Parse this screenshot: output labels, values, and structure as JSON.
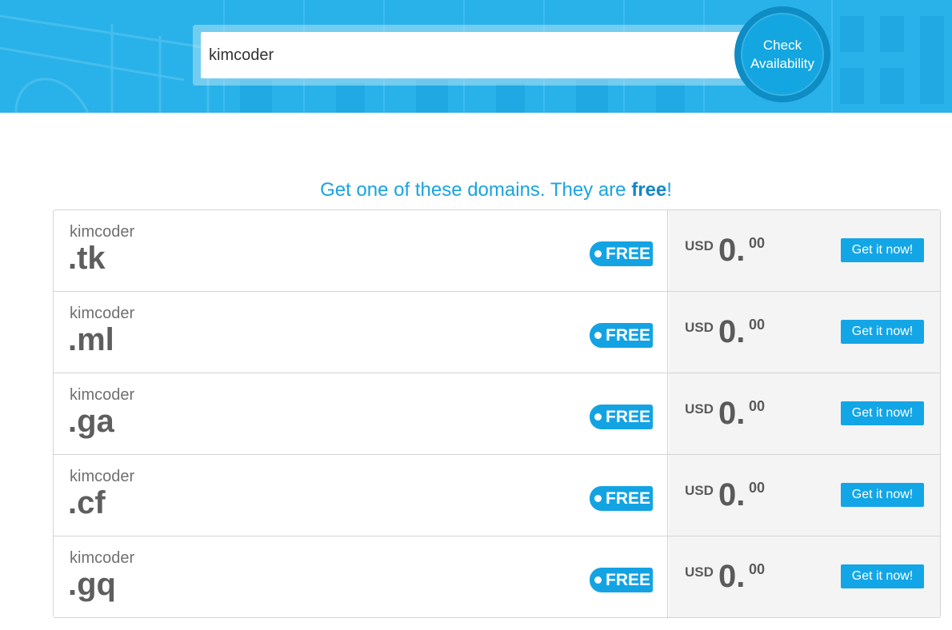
{
  "search": {
    "value": "kimcoder",
    "button_line1": "Check",
    "button_line2": "Availability"
  },
  "headline": {
    "prefix": "Get one of these domains. They are ",
    "emphasis": "free",
    "suffix": "!"
  },
  "domains": [
    {
      "name": "kimcoder",
      "tld": ".tk",
      "badge": "FREE",
      "currency": "USD",
      "price_int": "0.",
      "price_dec": "00",
      "action": "Get it now!"
    },
    {
      "name": "kimcoder",
      "tld": ".ml",
      "badge": "FREE",
      "currency": "USD",
      "price_int": "0.",
      "price_dec": "00",
      "action": "Get it now!"
    },
    {
      "name": "kimcoder",
      "tld": ".ga",
      "badge": "FREE",
      "currency": "USD",
      "price_int": "0.",
      "price_dec": "00",
      "action": "Get it now!"
    },
    {
      "name": "kimcoder",
      "tld": ".cf",
      "badge": "FREE",
      "currency": "USD",
      "price_int": "0.",
      "price_dec": "00",
      "action": "Get it now!"
    },
    {
      "name": "kimcoder",
      "tld": ".gq",
      "badge": "FREE",
      "currency": "USD",
      "price_int": "0.",
      "price_dec": "00",
      "action": "Get it now!"
    }
  ],
  "colors": {
    "accent": "#13a6e6",
    "hero": "#29b2ea",
    "panel": "#f4f4f4"
  }
}
